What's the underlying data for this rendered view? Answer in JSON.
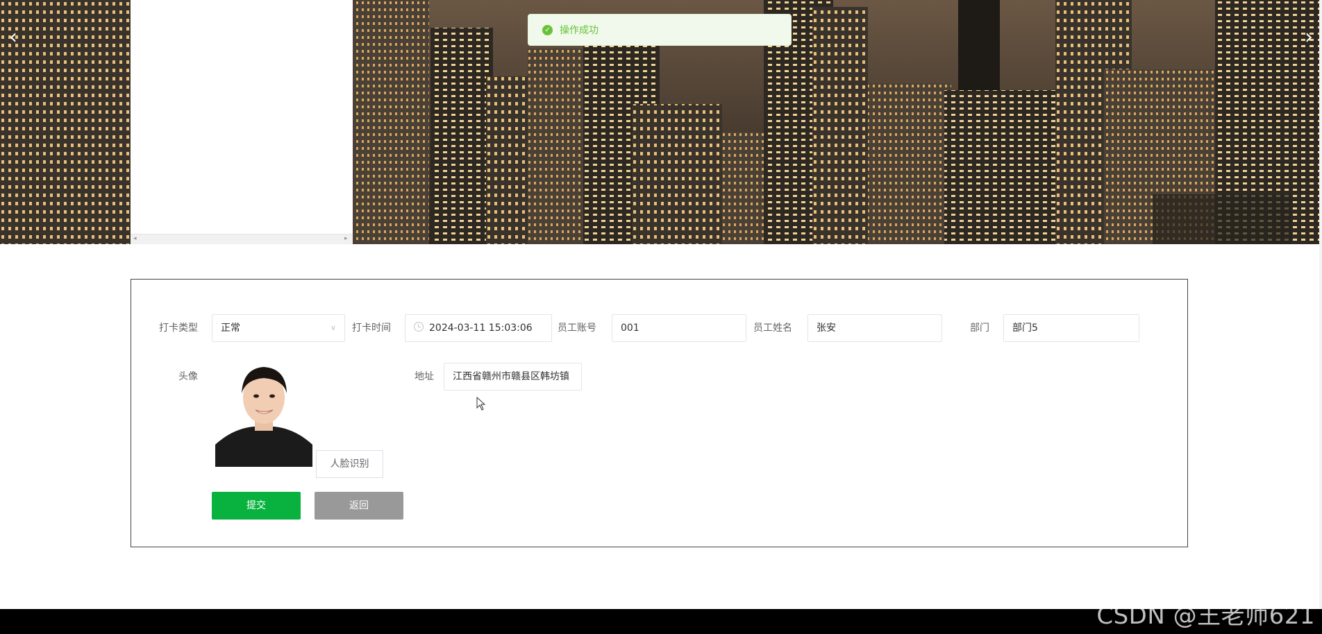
{
  "banner": {
    "prev_arrow": "‹",
    "next_arrow": "›"
  },
  "toast": {
    "message": "操作成功",
    "color": "#67c23a"
  },
  "form": {
    "punch_type": {
      "label": "打卡类型",
      "value": "正常"
    },
    "punch_time": {
      "label": "打卡时间",
      "value": "2024-03-11 15:03:06"
    },
    "employee_account": {
      "label": "员工账号",
      "value": "001"
    },
    "employee_name": {
      "label": "员工姓名",
      "value": "张安"
    },
    "department": {
      "label": "部门",
      "value": "部门5"
    },
    "avatar": {
      "label": "头像"
    },
    "address": {
      "label": "地址",
      "value": "江西省赣州市赣县区韩坊镇"
    },
    "face_recognition_label": "人脸识别",
    "submit_label": "提交",
    "back_label": "返回"
  },
  "colors": {
    "submit": "#09b23f",
    "back": "#999999",
    "footer": "#000000"
  },
  "watermark": "CSDN @王老师621"
}
